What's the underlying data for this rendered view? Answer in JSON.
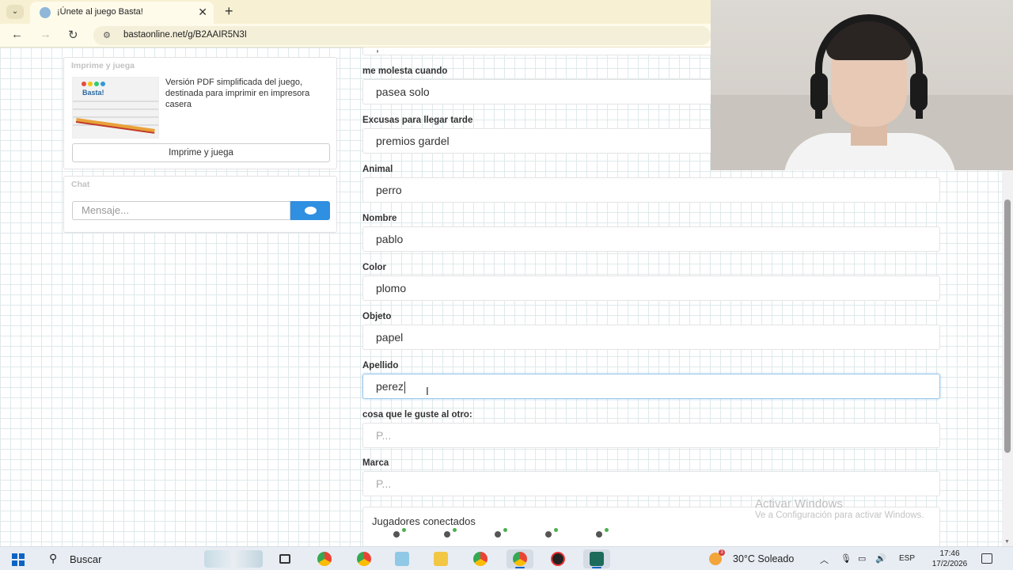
{
  "browser": {
    "tab_title": "¡Únete al juego Basta!",
    "tab_close": "✕",
    "new_tab": "+",
    "url": "bastaonline.net/g/B2AAIR5N3I"
  },
  "sidebar": {
    "print_panel": {
      "title": "Imprime y juega",
      "description": "Versión PDF simplificada del juego, destinada para imprimir en impresora casera",
      "thumbnail_label": "Basta!",
      "button_label": "Imprime y juega"
    },
    "chat_panel": {
      "title": "Chat",
      "input_placeholder": "Mensaje..."
    }
  },
  "form": {
    "partial_value": ",",
    "fields": [
      {
        "label": "me molesta cuando",
        "value": "pasea solo"
      },
      {
        "label": "Excusas para llegar tarde",
        "value": "premios gardel"
      },
      {
        "label": "Animal",
        "value": "perro"
      },
      {
        "label": "Nombre",
        "value": "pablo"
      },
      {
        "label": "Color",
        "value": "plomo"
      },
      {
        "label": "Objeto",
        "value": "papel"
      },
      {
        "label": "Apellido",
        "value": "perez"
      },
      {
        "label": "cosa que le guste al otro:",
        "placeholder": "P..."
      },
      {
        "label": "Marca",
        "placeholder": "P..."
      }
    ]
  },
  "players": {
    "title": "Jugadores conectados",
    "count_visible": 5
  },
  "watermark": {
    "line1": "Activar Windows",
    "line2": "Ve a Configuración para activar Windows."
  },
  "taskbar": {
    "search_label": "Buscar",
    "weather": "30°C  Soleado",
    "weather_badge": "3",
    "language": "ESP",
    "time": "17:46",
    "date": "17/2/2026"
  },
  "colors": {
    "accent": "#2f8fe0",
    "focus_border": "#9cc8ea",
    "grid_line": "#dfe9ea",
    "online_dot": "#4caf50"
  }
}
